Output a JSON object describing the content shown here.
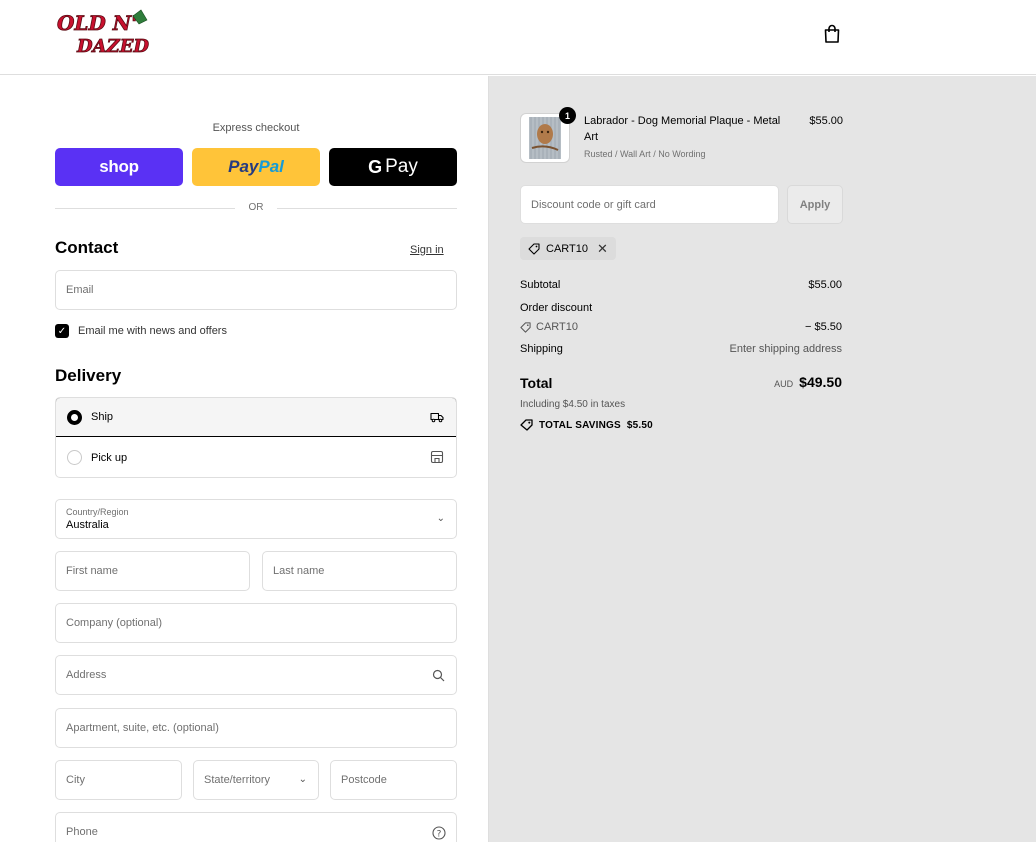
{
  "header": {
    "logo_line1": "OLD N'",
    "logo_line2": "DAZED"
  },
  "express": {
    "label": "Express checkout",
    "shop_label": "shop",
    "paypal_part1": "Pay",
    "paypal_part2": "Pal",
    "gpay_g": "G",
    "gpay_label": "Pay",
    "or_label": "OR"
  },
  "contact": {
    "title": "Contact",
    "sign_in": "Sign in",
    "email_placeholder": "Email",
    "news_label": "Email me with news and offers",
    "news_checked": true
  },
  "delivery": {
    "title": "Delivery",
    "options": [
      {
        "label": "Ship",
        "selected": true
      },
      {
        "label": "Pick up",
        "selected": false
      }
    ],
    "country_label": "Country/Region",
    "country_value": "Australia",
    "first_name": "First name",
    "last_name": "Last name",
    "company": "Company (optional)",
    "address": "Address",
    "apartment": "Apartment, suite, etc. (optional)",
    "city": "City",
    "state": "State/territory",
    "postcode": "Postcode",
    "phone": "Phone"
  },
  "order": {
    "product": {
      "name": "Labrador - Dog Memorial Plaque - Metal Art",
      "variant": "Rusted / Wall Art / No Wording",
      "price": "$55.00",
      "quantity": "1"
    },
    "discount_placeholder": "Discount code or gift card",
    "apply_label": "Apply",
    "applied_code": "CART10",
    "subtotal_label": "Subtotal",
    "subtotal_value": "$55.00",
    "order_discount_label": "Order discount",
    "discount_code": "CART10",
    "discount_value": "− $5.50",
    "shipping_label": "Shipping",
    "shipping_value": "Enter shipping address",
    "total_label": "Total",
    "currency": "AUD",
    "total_value": "$49.50",
    "tax_note": "Including $4.50 in taxes",
    "savings_label": "TOTAL SAVINGS",
    "savings_value": "$5.50"
  },
  "colors": {
    "shop": "#5a31f4",
    "paypal": "#ffc439",
    "gpay": "#000000",
    "summary_bg": "#e5e5e5"
  }
}
